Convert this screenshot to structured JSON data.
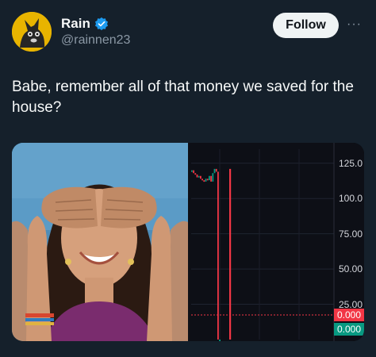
{
  "user": {
    "display_name": "Rain",
    "handle": "@rainnen23",
    "follow_label": "Follow",
    "more_label": "···"
  },
  "tweet": {
    "text": "Babe, remember all of that money we saved for the house?"
  },
  "colors": {
    "background": "#15202b",
    "verified_blue": "#1d9bf0",
    "follow_bg": "#eff3f4",
    "chart_red": "#f23645",
    "chart_green": "#089981"
  },
  "icons": {
    "verified": "verified-badge-icon",
    "more": "more-dots-icon"
  },
  "chart_data": {
    "type": "line",
    "ylim": [
      0,
      135
    ],
    "y_ticks": [
      "125.0",
      "100.0",
      "75.00",
      "50.00",
      "25.00"
    ],
    "price_labels": [
      {
        "label": "0.000",
        "color": "red"
      },
      {
        "label": "0.000",
        "color": "green"
      }
    ],
    "series": [
      {
        "x": [
          1,
          2,
          3,
          4,
          5,
          6,
          7,
          8,
          9,
          10,
          11,
          12,
          13,
          14,
          15,
          16,
          17
        ],
        "values": [
          120,
          118,
          117,
          115,
          116,
          114,
          113,
          112,
          114,
          113,
          116,
          112,
          118,
          121,
          119,
          0,
          0
        ]
      }
    ]
  }
}
